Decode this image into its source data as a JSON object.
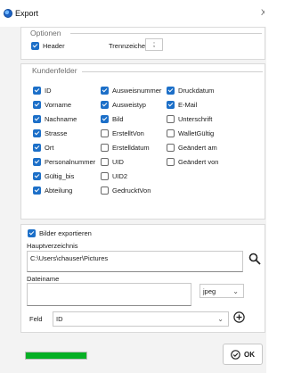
{
  "window": {
    "title": "Export",
    "close_glyph": "X"
  },
  "optionen": {
    "title": "Optionen",
    "header_label": "Header",
    "header_checked": true,
    "separator_label": "Trennzeichen",
    "separator_value": ";"
  },
  "kundenfelder": {
    "title": "Kundenfelder",
    "col1": [
      {
        "label": "ID",
        "checked": true
      },
      {
        "label": "Vorname",
        "checked": true
      },
      {
        "label": "Nachname",
        "checked": true
      },
      {
        "label": "Strasse",
        "checked": true
      },
      {
        "label": "Ort",
        "checked": true
      },
      {
        "label": "Personalnummer",
        "checked": true
      },
      {
        "label": "Gültig_bis",
        "checked": true
      },
      {
        "label": "Abteilung",
        "checked": true
      }
    ],
    "col2": [
      {
        "label": "Ausweisnummer",
        "checked": true
      },
      {
        "label": "Ausweistyp",
        "checked": true
      },
      {
        "label": "Bild",
        "checked": true
      },
      {
        "label": "ErstelltVon",
        "checked": false
      },
      {
        "label": "Erstelldatum",
        "checked": false
      },
      {
        "label": "UID",
        "checked": false
      },
      {
        "label": "UID2",
        "checked": false
      },
      {
        "label": "GedrucktVon",
        "checked": false
      }
    ],
    "col3": [
      {
        "label": "Druckdatum",
        "checked": true
      },
      {
        "label": "E-Mail",
        "checked": true
      },
      {
        "label": "Unterschrift",
        "checked": false
      },
      {
        "label": "WalletGültig",
        "checked": false
      },
      {
        "label": "Geändert am",
        "checked": false
      },
      {
        "label": "Geändert von",
        "checked": false
      }
    ]
  },
  "bilder": {
    "export_label": "Bilder exportieren",
    "export_checked": true,
    "dir_label": "Hauptverzeichnis",
    "dir_value": "C:\\Users\\chauser\\Pictures",
    "file_label": "Dateiname",
    "file_value": "",
    "format_value": "jpeg",
    "feld_label": "Feld",
    "feld_value": "ID"
  },
  "footer": {
    "ok_label": "OK",
    "progress": 1.0
  },
  "icons": {
    "app": "app-icon",
    "search": "search-icon",
    "add": "plus-circle-icon",
    "ok": "check-circle-icon",
    "chevron": "chevron-down-icon"
  },
  "colors": {
    "accent": "#1c6fc8",
    "progress": "#06b025"
  }
}
